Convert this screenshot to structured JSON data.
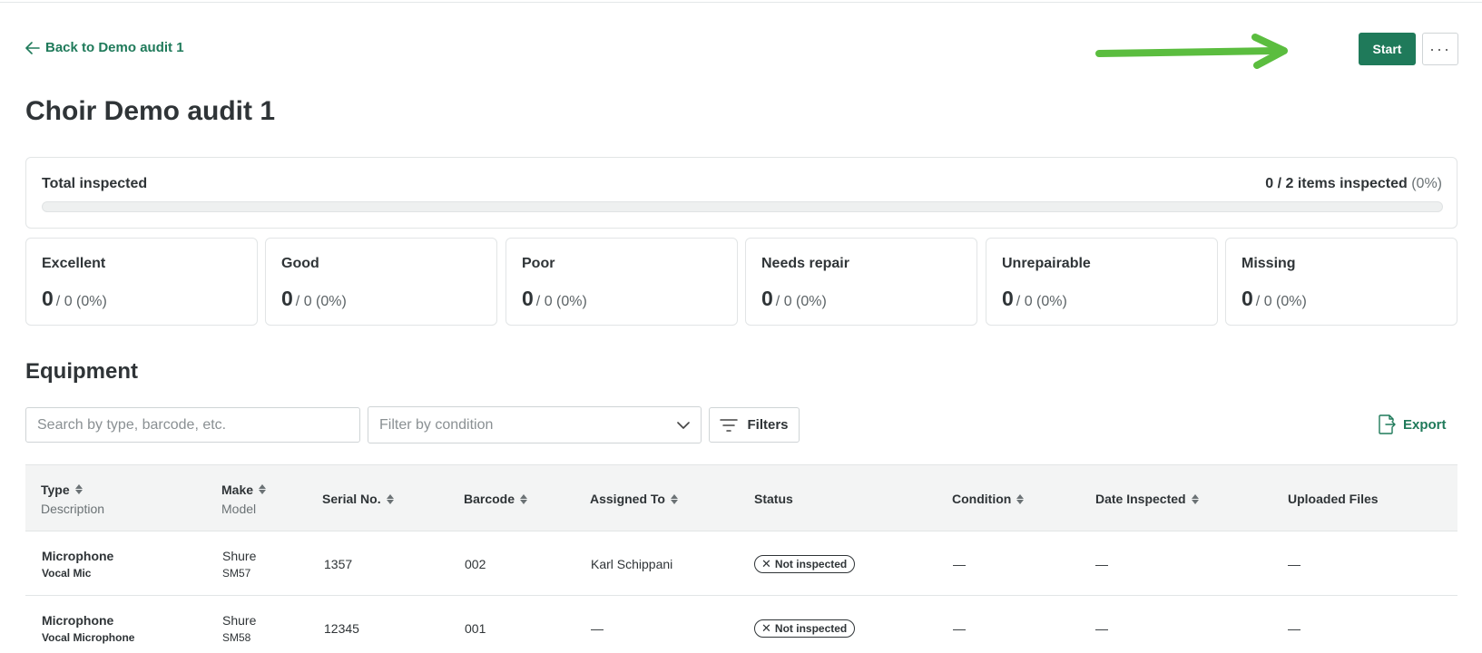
{
  "nav": {
    "back_label": "Back to Demo audit 1"
  },
  "header": {
    "start_label": "Start",
    "more_label": "···"
  },
  "page_title": "Choir Demo audit 1",
  "total": {
    "label": "Total inspected",
    "count_text": "0 / 2 items inspected",
    "percent_text": "(0%)",
    "progress": 0
  },
  "stats": [
    {
      "name": "Excellent",
      "value": "0",
      "detail": "/ 0 (0%)"
    },
    {
      "name": "Good",
      "value": "0",
      "detail": "/ 0 (0%)"
    },
    {
      "name": "Poor",
      "value": "0",
      "detail": "/ 0 (0%)"
    },
    {
      "name": "Needs repair",
      "value": "0",
      "detail": "/ 0 (0%)"
    },
    {
      "name": "Unrepairable",
      "value": "0",
      "detail": "/ 0 (0%)"
    },
    {
      "name": "Missing",
      "value": "0",
      "detail": "/ 0 (0%)"
    }
  ],
  "equipment": {
    "title": "Equipment",
    "search_placeholder": "Search by type, barcode, etc.",
    "condition_placeholder": "Filter by condition",
    "filters_label": "Filters",
    "export_label": "Export"
  },
  "table": {
    "headers": {
      "type": "Type",
      "description": "Description",
      "make": "Make",
      "model": "Model",
      "serial": "Serial No.",
      "barcode": "Barcode",
      "assigned": "Assigned To",
      "status": "Status",
      "condition": "Condition",
      "date": "Date Inspected",
      "files": "Uploaded Files"
    },
    "rows": [
      {
        "type": "Microphone",
        "description": "Vocal Mic",
        "make": "Shure",
        "model": "SM57",
        "serial": "1357",
        "barcode": "002",
        "assigned": "Karl Schippani",
        "status": "Not inspected",
        "condition": "—",
        "date": "—",
        "files": "—"
      },
      {
        "type": "Microphone",
        "description": "Vocal Microphone",
        "make": "Shure",
        "model": "SM58",
        "serial": "12345",
        "barcode": "001",
        "assigned": "—",
        "status": "Not inspected",
        "condition": "—",
        "date": "—",
        "files": "—"
      }
    ]
  },
  "colors": {
    "accent": "#1f7a5a",
    "annotation_arrow": "#5bbd3f"
  },
  "icons": [
    "arrow-left-icon",
    "annotation-arrow-icon",
    "chevron-down-icon",
    "filter-icon",
    "export-icon",
    "sort-icon",
    "close-icon"
  ]
}
